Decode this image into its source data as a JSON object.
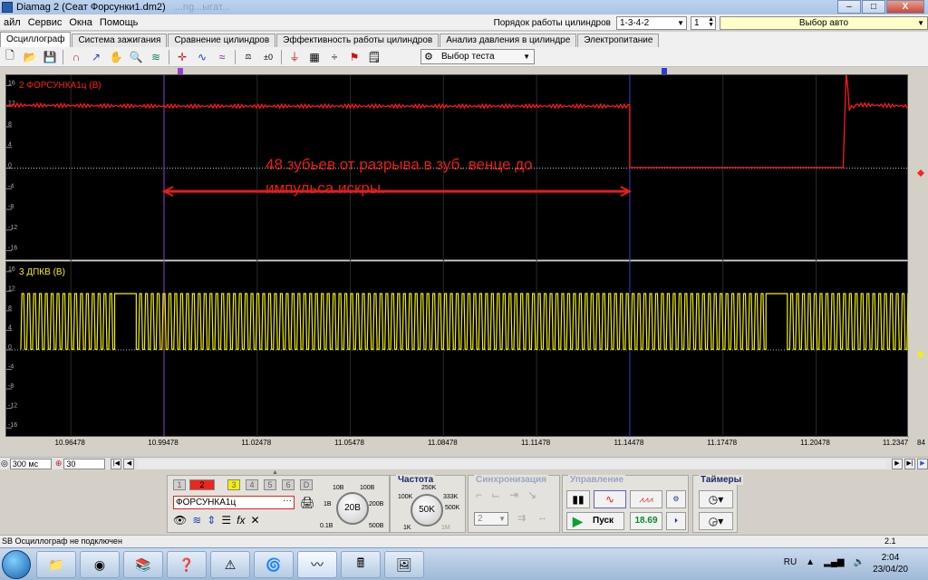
{
  "window": {
    "title": "Diamag 2 (Сеат Форсунки1.dm2)",
    "title_faded": "...ng...ыгат...",
    "buttons": {
      "minimize": "–",
      "maximize": "□",
      "close": "X"
    }
  },
  "menu": {
    "items": [
      "айл",
      "Сервис",
      "Окна",
      "Помощь"
    ],
    "firing_order_label": "Порядок работы цилиндров",
    "firing_order_value": "1-3-4-2",
    "cylinder_value": "1",
    "car_select_label": "Выбор авто"
  },
  "tabs": [
    "Осциллограф",
    "Система зажигания",
    "Сравнение цилиндров",
    "Эффективность работы цилиндров",
    "Анализ давления в цилиндре",
    "Электропитание"
  ],
  "toolbar": {
    "test_select_label": "Выбор теста"
  },
  "chart_data": [
    {
      "type": "line",
      "title": "2 ФОРСУНКА1ц (В)",
      "ylim": [
        -18,
        18
      ],
      "y_ticks": [
        "16",
        "12",
        "8",
        "4",
        "0",
        "-4",
        "-8",
        "-12",
        "-16"
      ],
      "series": [
        {
          "name": "2 ФОРСУНКА1ц (В)",
          "color": "#ff1a1a",
          "x": [
            10.944,
            10.99478,
            11.05478,
            11.11478,
            11.14478,
            11.14479,
            11.19,
            11.2135,
            11.2145,
            11.2155,
            11.2175,
            11.2347
          ],
          "y": [
            12.2,
            12.0,
            12.0,
            12.0,
            12.0,
            0.1,
            0.1,
            0.1,
            19.0,
            11.5,
            12.3,
            12.0
          ]
        }
      ],
      "annotation": {
        "text": "48 зубьев от разрыва в зуб. венце до импульса искры.",
        "arrow_from_x": 10.99478,
        "arrow_to_x": 11.14478,
        "arrow_y": -4.5
      },
      "level_marker": 0
    },
    {
      "type": "line",
      "title": "3 ДПКВ (В)",
      "ylim": [
        -18,
        18
      ],
      "y_ticks": [
        "16",
        "12",
        "8",
        "4",
        "0",
        "-4",
        "-8",
        "-12",
        "-16"
      ],
      "series": [
        {
          "name": "3 ДПКВ (В)",
          "color": "#f5f000",
          "pulse_high": 11.5,
          "pulse_low": 0.1,
          "gaps_x": [
            10.98,
            11.1897
          ]
        }
      ],
      "level_marker": 0
    }
  ],
  "x_axis": {
    "ticks": [
      "10.96478",
      "10.99478",
      "11.02478",
      "11.05478",
      "11.08478",
      "11.11478",
      "11.14478",
      "11.17478",
      "11.20478",
      "11.2347"
    ],
    "min": 10.944,
    "max": 11.2347,
    "right_edge_label": "84"
  },
  "cursors": {
    "cursor1": {
      "label": "1",
      "x": 10.99478
    },
    "cursor2": {
      "label": "2",
      "x": 11.14478
    }
  },
  "scroll_row": {
    "timebase": "300 мс",
    "zoom": "30"
  },
  "channels": {
    "buttons": [
      "1",
      "2",
      "3",
      "4",
      "5",
      "6",
      "D"
    ],
    "selected": "2",
    "name": "ФОРСУНКА1ц"
  },
  "range_knob": {
    "value": "20В",
    "labels": [
      "10В",
      "100В",
      "1В",
      "200В",
      "0.1В",
      "500В"
    ]
  },
  "frequency": {
    "title": "Частота",
    "value": "50K",
    "labels": [
      "250K",
      "100K",
      "333K",
      "500K",
      "1K",
      "1M"
    ]
  },
  "sync": {
    "title": "Синхронизация",
    "source": "2"
  },
  "control": {
    "title": "Управление",
    "start_label": "Пуск",
    "rpm": "18.69"
  },
  "timers": {
    "title": "Таймеры"
  },
  "status": {
    "left": "SB Осциллограф не подключен",
    "right": "2.1"
  },
  "taskbar": {
    "lang": "RU",
    "time": "2:04",
    "date": "23/04/20"
  }
}
